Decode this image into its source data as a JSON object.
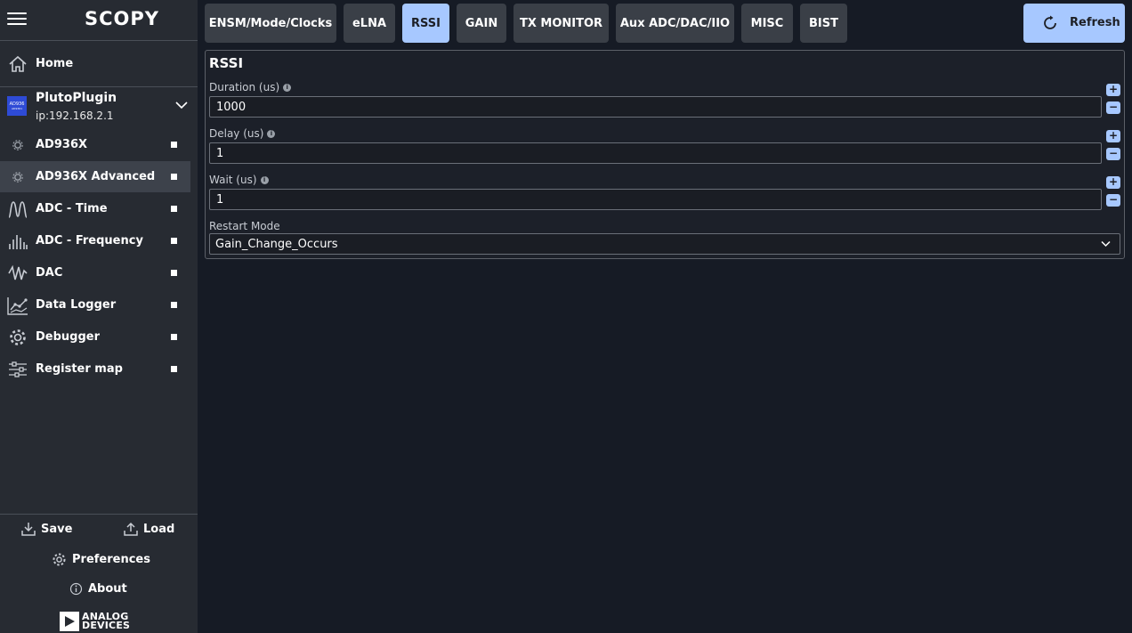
{
  "sidebar": {
    "logo": "SCOPY",
    "home_label": "Home",
    "device": {
      "name": "PlutoPlugin",
      "ip": "ip:192.168.2.1",
      "icon_text_top": "AD936",
      "icon_text_bottom": "AD9361"
    },
    "tools": [
      {
        "label": "AD936X",
        "icon": "gear-icon",
        "selected": false
      },
      {
        "label": "AD936X Advanced",
        "icon": "gear-icon",
        "selected": true
      },
      {
        "label": "ADC - Time",
        "icon": "time-wave-icon",
        "selected": false
      },
      {
        "label": "ADC - Frequency",
        "icon": "spectrum-icon",
        "selected": false
      },
      {
        "label": "DAC",
        "icon": "signal-generator-icon",
        "selected": false
      },
      {
        "label": "Data Logger",
        "icon": "data-logger-icon",
        "selected": false
      },
      {
        "label": "Debugger",
        "icon": "debugger-gear-icon",
        "selected": false
      },
      {
        "label": "Register map",
        "icon": "register-map-icon",
        "selected": false
      }
    ],
    "save_label": "Save",
    "load_label": "Load",
    "preferences_label": "Preferences",
    "about_label": "About",
    "brand_line1": "ANALOG",
    "brand_line2": "DEVICES"
  },
  "tabs": [
    {
      "label": "ENSM/Mode/Clocks",
      "active": false
    },
    {
      "label": "eLNA",
      "active": false
    },
    {
      "label": "RSSI",
      "active": true
    },
    {
      "label": "GAIN",
      "active": false
    },
    {
      "label": "TX MONITOR",
      "active": false
    },
    {
      "label": "Aux ADC/DAC/IIO",
      "active": false
    },
    {
      "label": "MISC",
      "active": false
    },
    {
      "label": "BIST",
      "active": false
    }
  ],
  "refresh_label": "Refresh",
  "panel": {
    "title": "RSSI",
    "fields": [
      {
        "label": "Duration (us)",
        "value": "1000"
      },
      {
        "label": "Delay (us)",
        "value": "1"
      },
      {
        "label": "Wait (us)",
        "value": "1"
      }
    ],
    "restart_mode": {
      "label": "Restart Mode",
      "value": "Gain_Change_Occurs"
    }
  },
  "colors": {
    "accent": "#a7c8ff",
    "background": "#161b25",
    "sidebar": "#272b32",
    "tab": "#3a3f47"
  }
}
